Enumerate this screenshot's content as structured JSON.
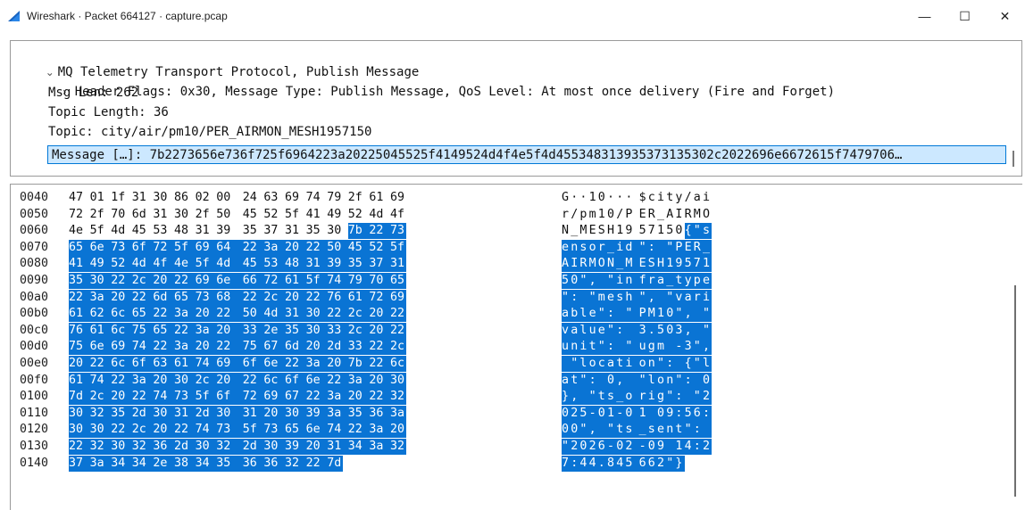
{
  "window": {
    "title": "Wireshark · Packet 664127 · capture.pcap",
    "controls": {
      "minimize": "—",
      "maximize": "☐",
      "close": "✕"
    },
    "accent": "#0078d7"
  },
  "details": {
    "root": "MQ Telemetry Transport Protocol, Publish Message",
    "header_flags": "Header Flags: 0x30, Message Type: Publish Message, QoS Level: At most once delivery (Fire and Forget)",
    "msg_len": "Msg Len: 262",
    "topic_length": "Topic Length: 36",
    "topic": "Topic: city/air/pm10/PER_AIRMON_MESH1957150",
    "message": "Message […]: 7b2273656e736f725f6964223a20225045525f4149524d4f4e5f4d455348313935373135302c2022696e6672615f7479706…"
  },
  "hex": {
    "selection_color": "#0a74d4",
    "rows": [
      {
        "offset": "0040",
        "bytes": [
          "47",
          "01",
          "1f",
          "31",
          "30",
          "86",
          "02",
          "00",
          "24",
          "63",
          "69",
          "74",
          "79",
          "2f",
          "61",
          "69"
        ],
        "ascii": [
          "G",
          "·",
          "·",
          "1",
          "0",
          "·",
          "·",
          "·",
          "$",
          "c",
          "i",
          "t",
          "y",
          "/",
          "a",
          "i"
        ]
      },
      {
        "offset": "0050",
        "bytes": [
          "72",
          "2f",
          "70",
          "6d",
          "31",
          "30",
          "2f",
          "50",
          "45",
          "52",
          "5f",
          "41",
          "49",
          "52",
          "4d",
          "4f"
        ],
        "ascii": [
          "r",
          "/",
          "p",
          "m",
          "1",
          "0",
          "/",
          "P",
          "E",
          "R",
          "_",
          "A",
          "I",
          "R",
          "M",
          "O"
        ]
      },
      {
        "offset": "0060",
        "bytes": [
          "4e",
          "5f",
          "4d",
          "45",
          "53",
          "48",
          "31",
          "39",
          "35",
          "37",
          "31",
          "35",
          "30",
          "7b",
          "22",
          "73"
        ],
        "ascii": [
          "N",
          "_",
          "M",
          "E",
          "S",
          "H",
          "1",
          "9",
          "5",
          "7",
          "1",
          "5",
          "0",
          "{",
          "\"",
          "s"
        ]
      },
      {
        "offset": "0070",
        "bytes": [
          "65",
          "6e",
          "73",
          "6f",
          "72",
          "5f",
          "69",
          "64",
          "22",
          "3a",
          "20",
          "22",
          "50",
          "45",
          "52",
          "5f"
        ],
        "ascii": [
          "e",
          "n",
          "s",
          "o",
          "r",
          "_",
          "i",
          "d",
          "\"",
          ":",
          " ",
          "\"",
          "P",
          "E",
          "R",
          "_"
        ]
      },
      {
        "offset": "0080",
        "bytes": [
          "41",
          "49",
          "52",
          "4d",
          "4f",
          "4e",
          "5f",
          "4d",
          "45",
          "53",
          "48",
          "31",
          "39",
          "35",
          "37",
          "31"
        ],
        "ascii": [
          "A",
          "I",
          "R",
          "M",
          "O",
          "N",
          "_",
          "M",
          "E",
          "S",
          "H",
          "1",
          "9",
          "5",
          "7",
          "1"
        ]
      },
      {
        "offset": "0090",
        "bytes": [
          "35",
          "30",
          "22",
          "2c",
          "20",
          "22",
          "69",
          "6e",
          "66",
          "72",
          "61",
          "5f",
          "74",
          "79",
          "70",
          "65"
        ],
        "ascii": [
          "5",
          "0",
          "\"",
          ",",
          " ",
          "\"",
          "i",
          "n",
          "f",
          "r",
          "a",
          "_",
          "t",
          "y",
          "p",
          "e"
        ]
      },
      {
        "offset": "00a0",
        "bytes": [
          "22",
          "3a",
          "20",
          "22",
          "6d",
          "65",
          "73",
          "68",
          "22",
          "2c",
          "20",
          "22",
          "76",
          "61",
          "72",
          "69"
        ],
        "ascii": [
          "\"",
          ":",
          " ",
          "\"",
          "m",
          "e",
          "s",
          "h",
          "\"",
          ",",
          " ",
          "\"",
          "v",
          "a",
          "r",
          "i"
        ]
      },
      {
        "offset": "00b0",
        "bytes": [
          "61",
          "62",
          "6c",
          "65",
          "22",
          "3a",
          "20",
          "22",
          "50",
          "4d",
          "31",
          "30",
          "22",
          "2c",
          "20",
          "22"
        ],
        "ascii": [
          "a",
          "b",
          "l",
          "e",
          "\"",
          ":",
          " ",
          "\"",
          "P",
          "M",
          "1",
          "0",
          "\"",
          ",",
          " ",
          "\""
        ]
      },
      {
        "offset": "00c0",
        "bytes": [
          "76",
          "61",
          "6c",
          "75",
          "65",
          "22",
          "3a",
          "20",
          "33",
          "2e",
          "35",
          "30",
          "33",
          "2c",
          "20",
          "22"
        ],
        "ascii": [
          "v",
          "a",
          "l",
          "u",
          "e",
          "\"",
          ":",
          " ",
          "3",
          ".",
          "5",
          "0",
          "3",
          ",",
          " ",
          "\""
        ]
      },
      {
        "offset": "00d0",
        "bytes": [
          "75",
          "6e",
          "69",
          "74",
          "22",
          "3a",
          "20",
          "22",
          "75",
          "67",
          "6d",
          "20",
          "2d",
          "33",
          "22",
          "2c"
        ],
        "ascii": [
          "u",
          "n",
          "i",
          "t",
          "\"",
          ":",
          " ",
          "\"",
          "u",
          "g",
          "m",
          " ",
          "-",
          "3",
          "\"",
          ","
        ]
      },
      {
        "offset": "00e0",
        "bytes": [
          "20",
          "22",
          "6c",
          "6f",
          "63",
          "61",
          "74",
          "69",
          "6f",
          "6e",
          "22",
          "3a",
          "20",
          "7b",
          "22",
          "6c"
        ],
        "ascii": [
          " ",
          "\"",
          "l",
          "o",
          "c",
          "a",
          "t",
          "i",
          "o",
          "n",
          "\"",
          ":",
          " ",
          "{",
          "\"",
          "l"
        ]
      },
      {
        "offset": "00f0",
        "bytes": [
          "61",
          "74",
          "22",
          "3a",
          "20",
          "30",
          "2c",
          "20",
          "22",
          "6c",
          "6f",
          "6e",
          "22",
          "3a",
          "20",
          "30"
        ],
        "ascii": [
          "a",
          "t",
          "\"",
          ":",
          " ",
          "0",
          ",",
          " ",
          "\"",
          "l",
          "o",
          "n",
          "\"",
          ":",
          " ",
          "0"
        ]
      },
      {
        "offset": "0100",
        "bytes": [
          "7d",
          "2c",
          "20",
          "22",
          "74",
          "73",
          "5f",
          "6f",
          "72",
          "69",
          "67",
          "22",
          "3a",
          "20",
          "22",
          "32"
        ],
        "ascii": [
          "}",
          ",",
          " ",
          "\"",
          "t",
          "s",
          "_",
          "o",
          "r",
          "i",
          "g",
          "\"",
          ":",
          " ",
          "\"",
          "2"
        ]
      },
      {
        "offset": "0110",
        "bytes": [
          "30",
          "32",
          "35",
          "2d",
          "30",
          "31",
          "2d",
          "30",
          "31",
          "20",
          "30",
          "39",
          "3a",
          "35",
          "36",
          "3a"
        ],
        "ascii": [
          "0",
          "2",
          "5",
          "-",
          "0",
          "1",
          "-",
          "0",
          "1",
          " ",
          "0",
          "9",
          ":",
          "5",
          "6",
          ":"
        ]
      },
      {
        "offset": "0120",
        "bytes": [
          "30",
          "30",
          "22",
          "2c",
          "20",
          "22",
          "74",
          "73",
          "5f",
          "73",
          "65",
          "6e",
          "74",
          "22",
          "3a",
          "20"
        ],
        "ascii": [
          "0",
          "0",
          "\"",
          ",",
          " ",
          "\"",
          "t",
          "s",
          "_",
          "s",
          "e",
          "n",
          "t",
          "\"",
          ":",
          " "
        ]
      },
      {
        "offset": "0130",
        "bytes": [
          "22",
          "32",
          "30",
          "32",
          "36",
          "2d",
          "30",
          "32",
          "2d",
          "30",
          "39",
          "20",
          "31",
          "34",
          "3a",
          "32"
        ],
        "ascii": [
          "\"",
          "2",
          "0",
          "2",
          "6",
          "-",
          "0",
          "2",
          "-",
          "0",
          "9",
          " ",
          "1",
          "4",
          ":",
          "2"
        ]
      },
      {
        "offset": "0140",
        "bytes": [
          "37",
          "3a",
          "34",
          "34",
          "2e",
          "38",
          "34",
          "35",
          "36",
          "36",
          "32",
          "22",
          "7d"
        ],
        "ascii": [
          "7",
          ":",
          "4",
          "4",
          ".",
          "8",
          "4",
          "5",
          "6",
          "6",
          "2",
          "\"",
          "}"
        ]
      }
    ],
    "selection_start_row": 2,
    "selection_start_col": 13
  }
}
